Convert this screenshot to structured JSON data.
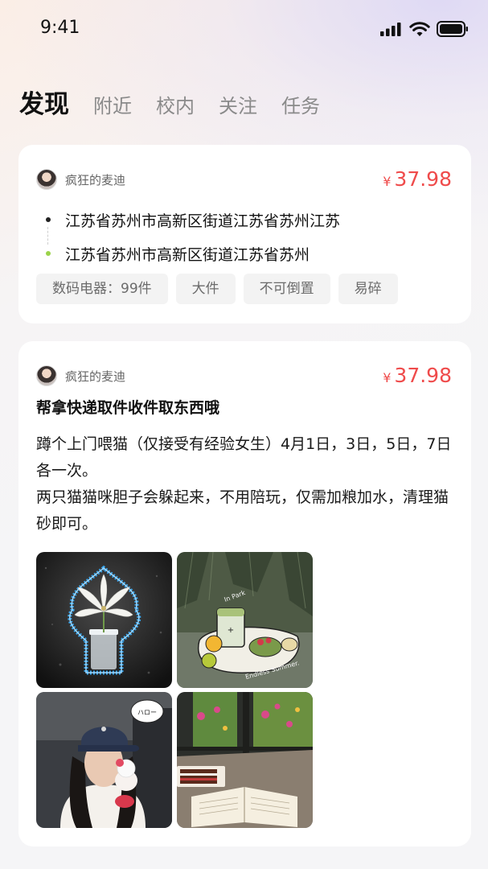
{
  "status_bar": {
    "time": "9:41"
  },
  "tabs": [
    {
      "label": "发现",
      "active": true
    },
    {
      "label": "附近",
      "active": false
    },
    {
      "label": "校内",
      "active": false
    },
    {
      "label": "关注",
      "active": false
    },
    {
      "label": "任务",
      "active": false
    }
  ],
  "feed": [
    {
      "user": "疯狂的麦迪",
      "currency": "¥",
      "price": "37.98",
      "route": {
        "from": "江苏省苏州市高新区街道江苏省苏州江苏",
        "to": "江苏省苏州市高新区街道江苏省苏州"
      },
      "tags": [
        "数码电器：99件",
        "大件",
        "不可倒置",
        "易碎"
      ]
    },
    {
      "user": "疯狂的麦迪",
      "currency": "¥",
      "price": "37.98",
      "title": "帮拿快递取件收件取东西哦",
      "body_lines": [
        "蹲个上门喂猫（仅接受有经验女生）4月1日，3日，5日，7日各一次。",
        "两只猫猫咪胆子会躲起来，不用陪玩，仅需加粮加水，清理猫砂即可。"
      ],
      "photos": [
        {
          "icon": "lily-in-cup-photo"
        },
        {
          "icon": "matcha-picnic-photo",
          "caption_top": "In Park",
          "caption_bottom": "Endless Summer."
        },
        {
          "icon": "girl-with-cap-photo",
          "bubble": "ハロー"
        },
        {
          "icon": "cake-and-book-photo"
        }
      ]
    }
  ],
  "colors": {
    "price": "#ef4b4b",
    "route_end_dot": "#9bd34a",
    "tag_bg": "#f3f3f3"
  }
}
